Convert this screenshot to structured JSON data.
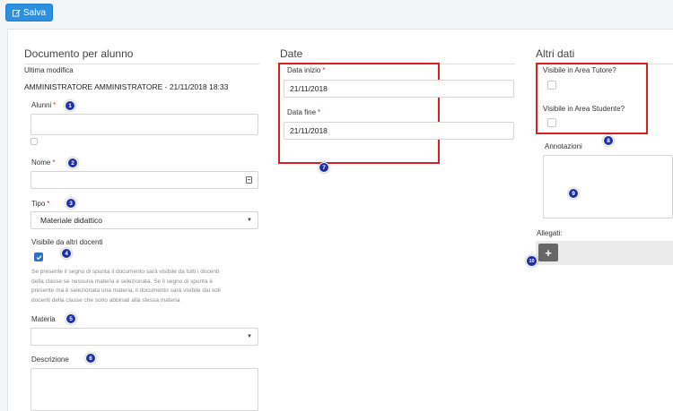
{
  "toolbar": {
    "save_label": "Salva"
  },
  "sections": {
    "documento": "Documento per alunno",
    "date": "Date",
    "altri": "Altri dati"
  },
  "documento": {
    "last_modified_label": "Ultima modifica",
    "last_modified_value": "AMMINISTRATORE AMMINISTRATORE - 21/11/2018 18:33",
    "alunni_label": "Alunni",
    "nome_label": "Nome",
    "tipo_label": "Tipo",
    "tipo_value": "Materiale didattico",
    "visibile_label": "Visibile da altri docenti",
    "visibile_checked": true,
    "visibile_help_1": "Se presente il segno di spunta il documento sarà visibile da tutti i docenti",
    "visibile_help_2": "della classe se nessuna materia è selezionata. Se il segno di spunta è",
    "visibile_help_3": "presente ma è selezionata una materia, il documento sarà visibile dai soli",
    "visibile_help_4": "docenti della classe che sono abbinati alla stessa materia",
    "materia_label": "Materia",
    "materia_value": "",
    "descrizione_label": "Descrizione",
    "required_mark": "*"
  },
  "date": {
    "inizio_label": "Data inizio",
    "inizio_value": "21/11/2018",
    "fine_label": "Data fine",
    "fine_value": "21/11/2018"
  },
  "altri": {
    "tutore_label": "Visibile in Area Tutore?",
    "studente_label": "Visibile in Area Studente?",
    "annotazioni_label": "Annotazioni",
    "allegati_label": "Allegati:",
    "add_label": "+"
  },
  "badges": [
    "1",
    "2",
    "3",
    "4",
    "5",
    "6",
    "7",
    "8",
    "9",
    "10"
  ],
  "colors": {
    "primary": "#2d8fe0",
    "required": "#d9302c",
    "highlight": "#d42020",
    "badge": "#1f2fa8",
    "checkbox_on": "#2f72c4"
  },
  "icons": {
    "save": "edit-icon",
    "nome": "calendar-icon",
    "visibile": "check-icon",
    "add": "plus-icon"
  }
}
